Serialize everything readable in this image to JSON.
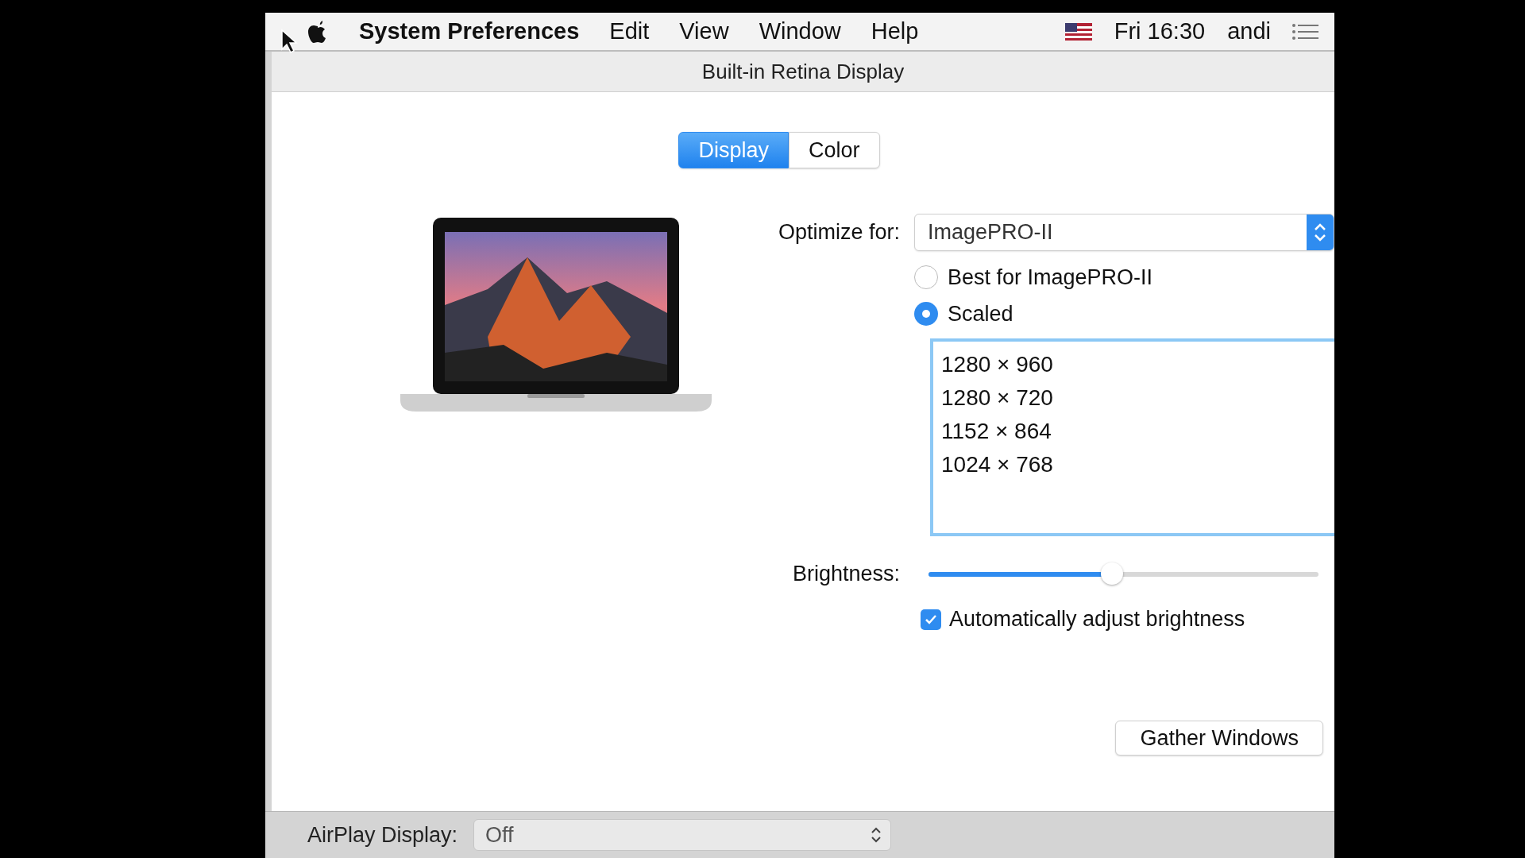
{
  "menu_bar": {
    "app_name": "System Preferences",
    "menus": [
      "Edit",
      "View",
      "Window",
      "Help"
    ],
    "clock": "Fri 16:30",
    "user": "andi"
  },
  "window": {
    "title": "Built-in Retina Display"
  },
  "tabs": [
    {
      "label": "Display",
      "selected": true
    },
    {
      "label": "Color",
      "selected": false
    }
  ],
  "optimize": {
    "label": "Optimize for:",
    "value": "ImagePRO-II"
  },
  "resolution_modes": [
    {
      "label": "Best for ImagePRO-II",
      "selected": false
    },
    {
      "label": "Scaled",
      "selected": true
    }
  ],
  "resolutions": [
    {
      "label": "1280 × 960",
      "selected": false
    },
    {
      "label": "1280 × 720",
      "selected": false
    },
    {
      "label": "1152 × 864",
      "selected": false
    },
    {
      "label": "1024 × 768",
      "selected": false
    }
  ],
  "brightness": {
    "label": "Brightness:",
    "level": 0.47
  },
  "auto_brightness": {
    "label": "Automatically adjust brightness",
    "checked": true
  },
  "gather_button": "Gather Windows",
  "airplay": {
    "label": "AirPlay Display:",
    "value": "Off"
  }
}
